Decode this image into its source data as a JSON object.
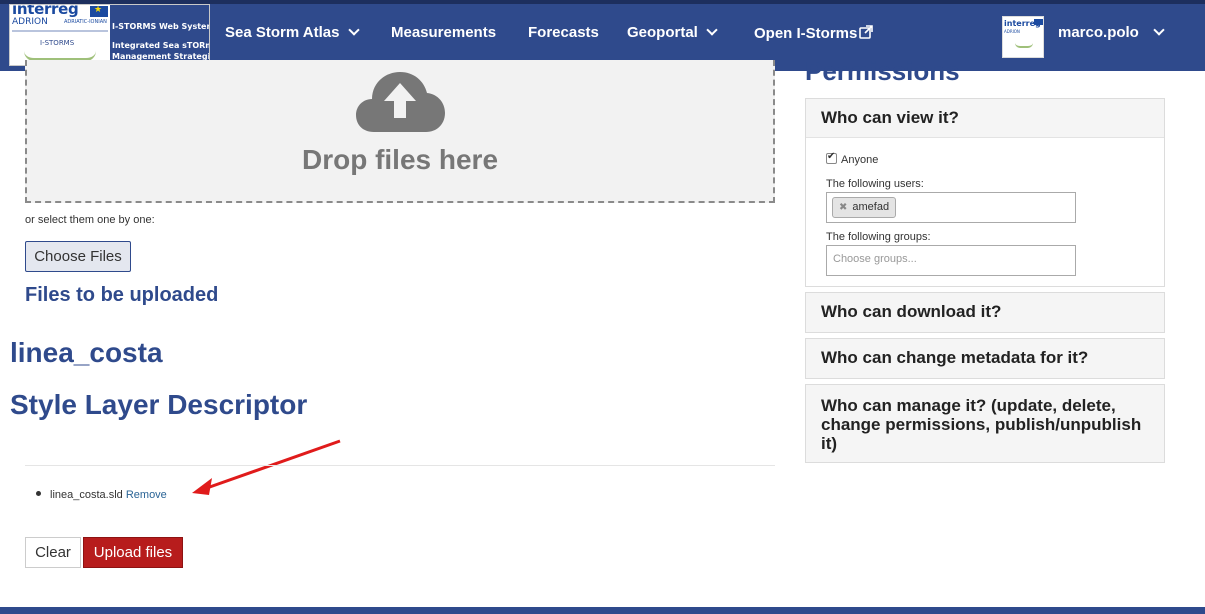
{
  "header": {
    "logo": {
      "brand": "interreg",
      "program": "ADRION",
      "program_sub": "ADRIATIC-IONIAN",
      "project": "I-STORMS",
      "system_line": "I-STORMS Web System",
      "tagline_1": "Integrated Sea sTORm",
      "tagline_2": "Management Strategies"
    },
    "nav": [
      {
        "label": "Sea Storm Atlas",
        "dropdown": true
      },
      {
        "label": "Measurements",
        "dropdown": false
      },
      {
        "label": "Forecasts",
        "dropdown": false
      },
      {
        "label": "Geoportal",
        "dropdown": true
      },
      {
        "label": "Open I-Storms",
        "external": true
      }
    ],
    "user": {
      "name": "marco.polo",
      "avatar_brand": "interreg",
      "avatar_program": "ADRION"
    },
    "colors": {
      "nav_bg": "#2f4a8c",
      "accent_red": "#b71c1c",
      "heading": "#2f4a8c"
    }
  },
  "upload": {
    "drop_text": "Drop files here",
    "drop_icon": "cloud-upload-icon",
    "select_note": "or select them one by one:",
    "choose_label": "Choose Files",
    "files_heading": "Files to be uploaded",
    "layer_name": "linea_costa",
    "sld_heading": "Style Layer Descriptor",
    "files": [
      {
        "name": "linea_costa.sld",
        "remove_label": "Remove"
      }
    ],
    "clear_label": "Clear",
    "upload_label": "Upload files"
  },
  "permissions": {
    "title": "Permissions",
    "view": {
      "heading": "Who can view it?",
      "anyone_label": "Anyone",
      "anyone_checked": true,
      "users_label": "The following users:",
      "users": [
        "amefad"
      ],
      "groups_label": "The following groups:",
      "groups_placeholder": "Choose groups..."
    },
    "download_heading": "Who can download it?",
    "metadata_heading": "Who can change metadata for it?",
    "manage_heading": "Who can manage it? (update, delete, change permissions, publish/unpublish it)"
  }
}
